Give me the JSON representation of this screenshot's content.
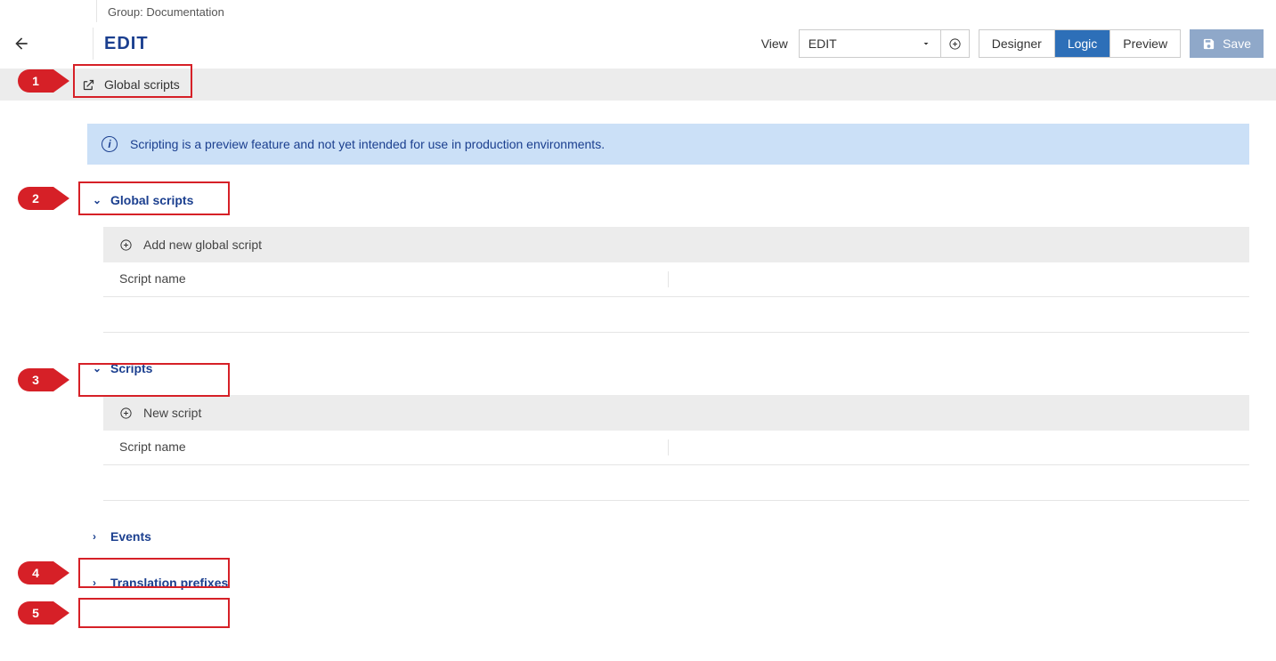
{
  "breadcrumb": {
    "label": "Group: Documentation"
  },
  "header": {
    "title": "EDIT",
    "view_label": "View",
    "view_selected": "EDIT",
    "tabs": {
      "designer": "Designer",
      "logic": "Logic",
      "preview": "Preview"
    },
    "save_label": "Save"
  },
  "global_bar": {
    "label": "Global scripts"
  },
  "banner": {
    "text": "Scripting is a preview feature and not yet intended for use in production environments."
  },
  "sections": {
    "global_scripts": {
      "title": "Global scripts",
      "add_label": "Add new global script",
      "col_name": "Script name"
    },
    "scripts": {
      "title": "Scripts",
      "add_label": "New script",
      "col_name": "Script name"
    },
    "events": {
      "title": "Events"
    },
    "translation": {
      "title": "Translation prefixes"
    }
  },
  "callouts": {
    "c1": "1",
    "c2": "2",
    "c3": "3",
    "c4": "4",
    "c5": "5"
  }
}
